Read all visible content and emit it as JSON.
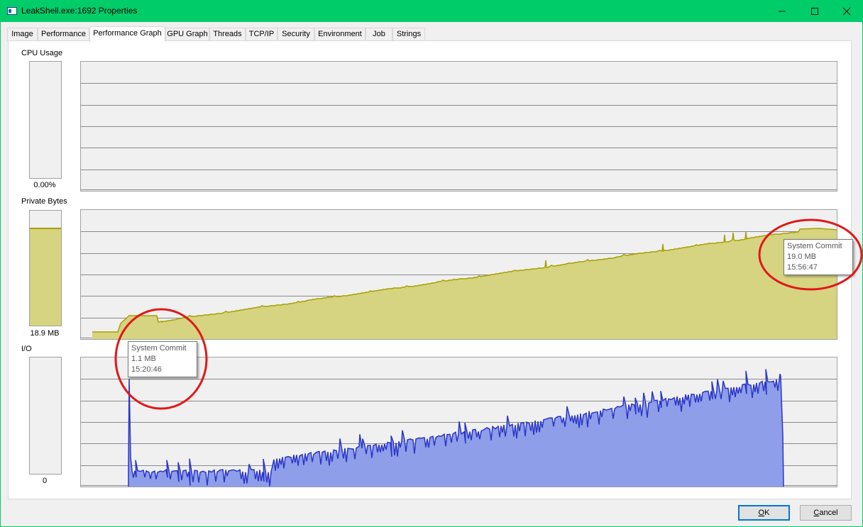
{
  "window": {
    "title": "LeakShell.exe:1692 Properties",
    "accent_color": "#00cc6a"
  },
  "tabs": [
    {
      "label": "Image",
      "active": false
    },
    {
      "label": "Performance",
      "active": false
    },
    {
      "label": "Performance Graph",
      "active": true
    },
    {
      "label": "GPU Graph",
      "active": false
    },
    {
      "label": "Threads",
      "active": false
    },
    {
      "label": "TCP/IP",
      "active": false
    },
    {
      "label": "Security",
      "active": false
    },
    {
      "label": "Environment",
      "active": false
    },
    {
      "label": "Job",
      "active": false
    },
    {
      "label": "Strings",
      "active": false
    }
  ],
  "cpu": {
    "label": "CPU Usage",
    "value": "0.00%",
    "level": 0
  },
  "private_bytes": {
    "label": "Private Bytes",
    "value": "18.9 MB",
    "level": 0.85,
    "fill_color": "#d6d480",
    "line_color": "#a8a000"
  },
  "io": {
    "label": "I/O",
    "value": "0",
    "level": 0,
    "fill_color": "#8e9ee8",
    "line_color": "#2a35c8"
  },
  "tooltips": {
    "left": {
      "title": "System Commit",
      "value": "1.1 MB",
      "time": "15:20:46"
    },
    "right": {
      "title": "System Commit",
      "value": "19.0 MB",
      "time": "15:56:47"
    }
  },
  "annotation_color": "#e01818",
  "buttons": {
    "ok": {
      "prefix": "",
      "accel": "O",
      "rest": "K"
    },
    "cancel": {
      "prefix": "",
      "accel": "C",
      "rest": "ancel"
    }
  },
  "icons": {
    "app": "window-properties-icon",
    "minimize": "minimize-icon",
    "maximize": "maximize-icon",
    "close": "close-icon"
  }
}
